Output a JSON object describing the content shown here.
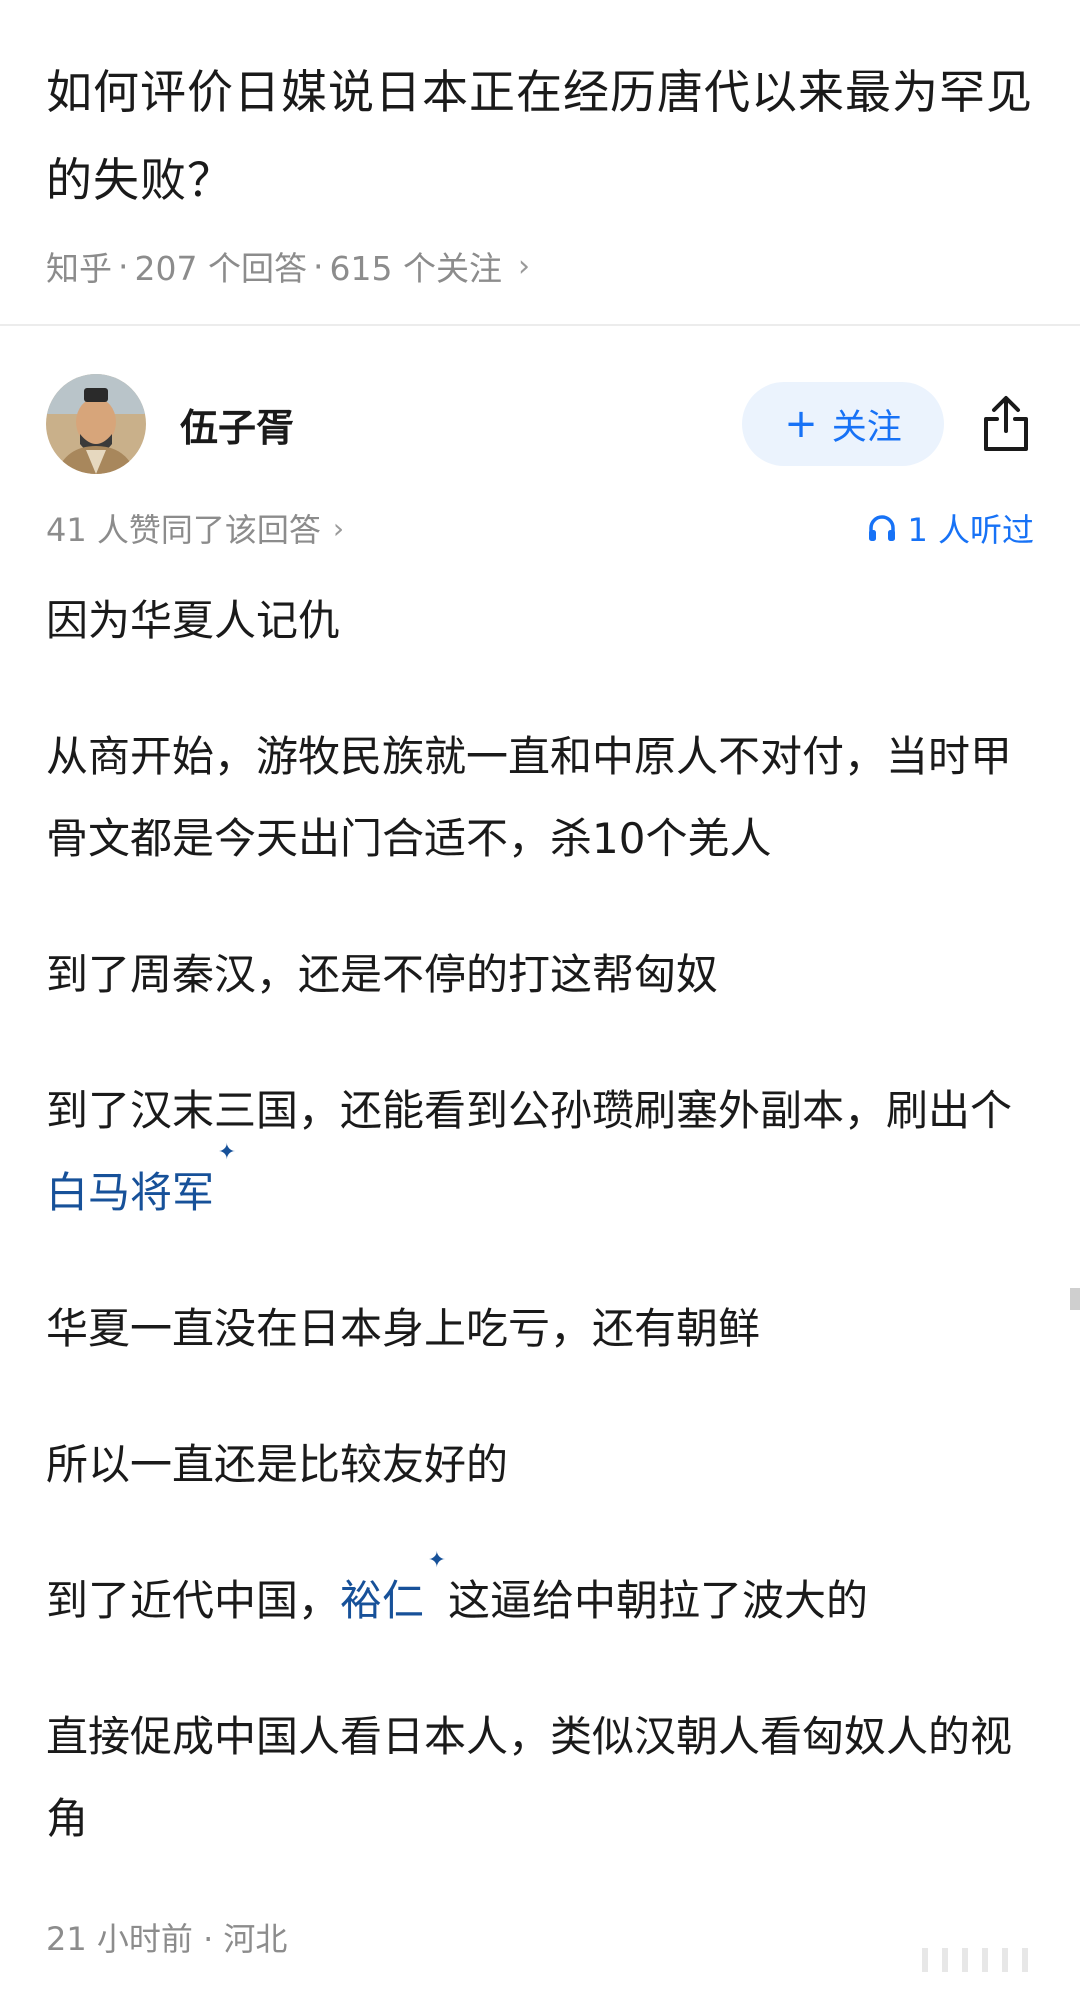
{
  "question": {
    "title": "如何评价日媒说日本正在经历唐代以来最为罕见的失败？",
    "source": "知乎",
    "answers": "207 个回答",
    "followers": "615 个关注",
    "separator": "·"
  },
  "author": {
    "name": "伍子胥",
    "follow_label": "关注"
  },
  "stats": {
    "upvotes": "41 人赞同了该回答",
    "listened": "1 人听过"
  },
  "content": {
    "p1": "因为华夏人记仇",
    "p2": "从商开始，游牧民族就一直和中原人不对付，当时甲骨文都是今天出门合适不，杀10个羌人",
    "p3": "到了周秦汉，还是不停的打这帮匈奴",
    "p4_before": "到了汉末三国，还能看到公孙瓒刷塞外副本，刷出个",
    "p4_link": "白马将军",
    "p5": "华夏一直没在日本身上吃亏，还有朝鲜",
    "p6": "所以一直还是比较友好的",
    "p7_before": "到了近代中国，",
    "p7_link": "裕仁",
    "p7_after": "这逼给中朝拉了波大的",
    "p8": "直接促成中国人看日本人，类似汉朝人看匈奴人的视角"
  },
  "footer": {
    "time_location": "21 小时前 · 河北"
  },
  "icons": {
    "chevron": "chevron-right-icon",
    "share": "share-icon",
    "headphones": "headphones-icon",
    "spark": "spark-icon",
    "plus": "plus-icon"
  },
  "colors": {
    "accent": "#1772f6",
    "link": "#175199",
    "follow_bg": "#ebf3fd",
    "meta": "#8c8c8c"
  }
}
